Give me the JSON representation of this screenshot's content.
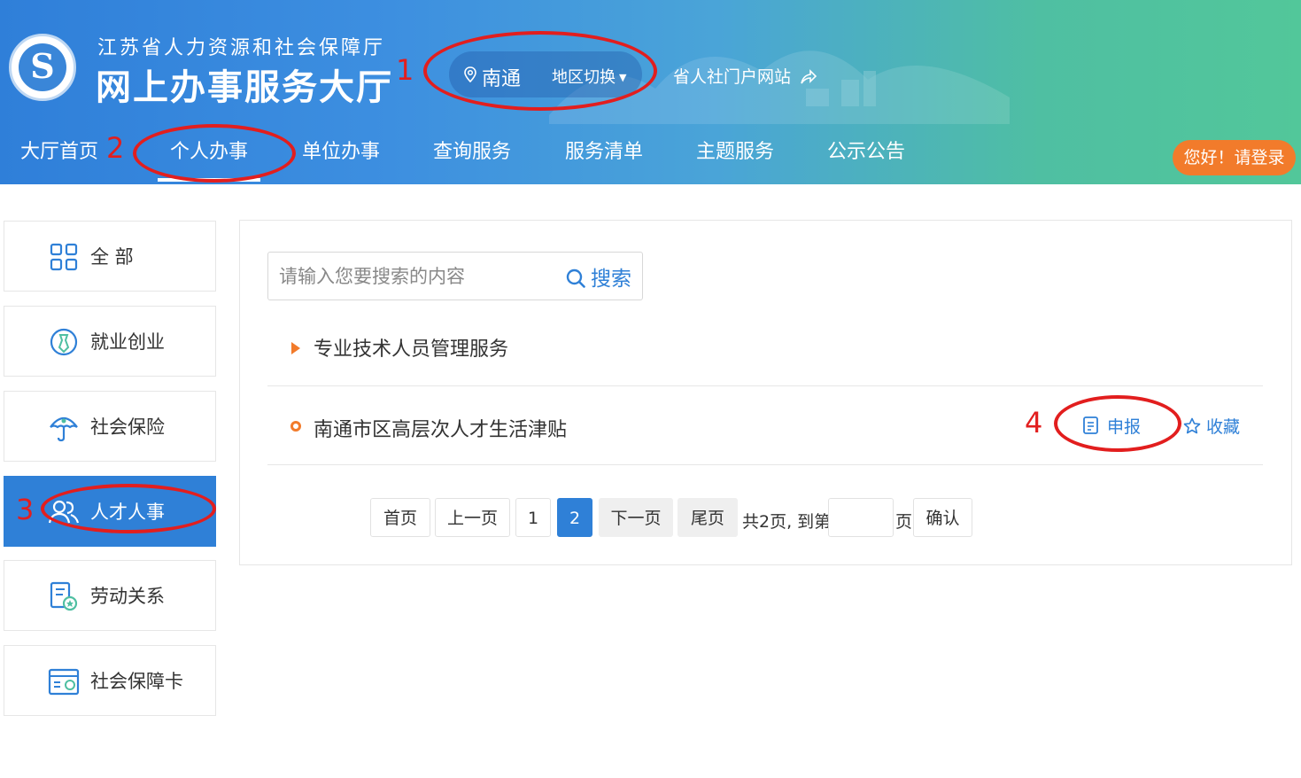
{
  "header": {
    "org_name": "江苏省人力资源和社会保障厅",
    "site_title": "网上办事服务大厅",
    "region": "南通",
    "region_switch": "地区切换",
    "portal_link": "省人社门户网站",
    "login_button": "您好！请登录",
    "nav": [
      {
        "label": "大厅首页",
        "active": false
      },
      {
        "label": "个人办事",
        "active": true
      },
      {
        "label": "单位办事",
        "active": false
      },
      {
        "label": "查询服务",
        "active": false
      },
      {
        "label": "服务清单",
        "active": false
      },
      {
        "label": "主题服务",
        "active": false
      },
      {
        "label": "公示公告",
        "active": false
      }
    ],
    "brand_color": "#2f80d7",
    "accent_color": "#f27b2b"
  },
  "annotations": {
    "marker_1": "1",
    "marker_2": "2",
    "marker_3": "3",
    "marker_4": "4",
    "color": "#e21e1e"
  },
  "sidebar": {
    "items": [
      {
        "label": "全 部",
        "icon": "grid-icon",
        "active": false
      },
      {
        "label": "就业创业",
        "icon": "employment-icon",
        "active": false
      },
      {
        "label": "社会保险",
        "icon": "umbrella-icon",
        "active": false
      },
      {
        "label": "人才人事",
        "icon": "people-icon",
        "active": true
      },
      {
        "label": "劳动关系",
        "icon": "contract-icon",
        "active": false
      },
      {
        "label": "社会保障卡",
        "icon": "card-icon",
        "active": false
      }
    ]
  },
  "main": {
    "search": {
      "placeholder": "请输入您要搜索的内容",
      "button_label": "搜索"
    },
    "category": "专业技术人员管理服务",
    "items": [
      {
        "title": "南通市区高层次人才生活津贴",
        "apply_label": "申报",
        "favorite_label": "收藏"
      }
    ],
    "pagination": {
      "first": "首页",
      "prev": "上一页",
      "pages": [
        "1",
        "2"
      ],
      "current_page": "2",
      "next": "下一页",
      "last": "尾页",
      "total_text": "共2页, 到第",
      "page_suffix": "页",
      "confirm": "确认"
    }
  }
}
